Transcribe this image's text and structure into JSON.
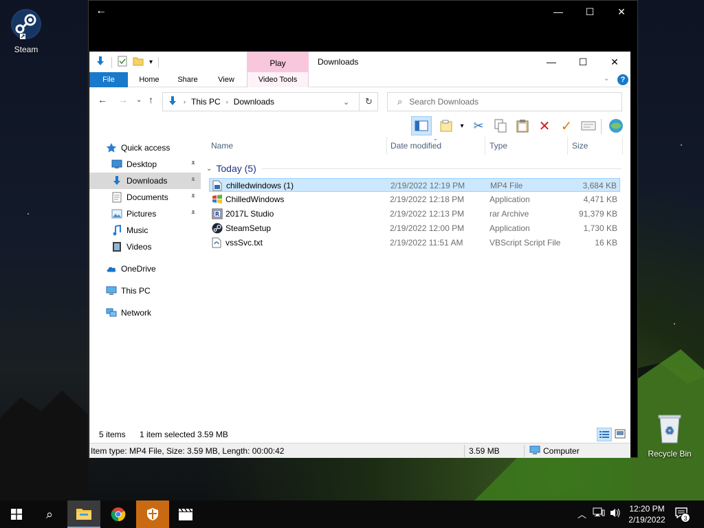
{
  "desktop": {
    "icons": [
      {
        "label": "Steam",
        "icon": "steam-icon"
      },
      {
        "label": "Recycle Bin",
        "icon": "recycle-bin-icon"
      }
    ]
  },
  "outer_window": {
    "back_glyph": "←",
    "minimize_glyph": "—",
    "maximize_glyph": "☐",
    "close_glyph": "✕"
  },
  "explorer": {
    "title": "Downloads",
    "contextual_tab_group": "Play",
    "ribbon_tabs": [
      "File",
      "Home",
      "Share",
      "View",
      "Video Tools"
    ],
    "address": {
      "crumbs": [
        "This PC",
        "Downloads"
      ]
    },
    "search_placeholder": "Search Downloads",
    "nav": [
      {
        "label": "Quick access",
        "icon": "star-icon",
        "indent": false,
        "pinned": false
      },
      {
        "label": "Desktop",
        "icon": "desktop-folder-icon",
        "indent": true,
        "pinned": true
      },
      {
        "label": "Downloads",
        "icon": "downloads-folder-icon",
        "indent": true,
        "pinned": true,
        "selected": true
      },
      {
        "label": "Documents",
        "icon": "documents-folder-icon",
        "indent": true,
        "pinned": true
      },
      {
        "label": "Pictures",
        "icon": "pictures-folder-icon",
        "indent": true,
        "pinned": true
      },
      {
        "label": "Music",
        "icon": "music-folder-icon",
        "indent": true,
        "pinned": false
      },
      {
        "label": "Videos",
        "icon": "videos-folder-icon",
        "indent": true,
        "pinned": false
      },
      {
        "label": "OneDrive",
        "icon": "onedrive-icon",
        "indent": false,
        "pinned": false
      },
      {
        "label": "This PC",
        "icon": "this-pc-icon",
        "indent": false,
        "pinned": false
      },
      {
        "label": "Network",
        "icon": "network-icon",
        "indent": false,
        "pinned": false
      }
    ],
    "columns": [
      "Name",
      "Date modified",
      "Type",
      "Size"
    ],
    "group": "Today (5)",
    "files": [
      {
        "name": "chilledwindows (1)",
        "date": "2/19/2022 12:19 PM",
        "type": "MP4 File",
        "size": "3,684 KB",
        "icon": "video-file-icon",
        "selected": true
      },
      {
        "name": "ChilledWindows",
        "date": "2/19/2022 12:18 PM",
        "type": "Application",
        "size": "4,471 KB",
        "icon": "windows-app-icon"
      },
      {
        "name": "2017L Studio",
        "date": "2/19/2022 12:13 PM",
        "type": "rar Archive",
        "size": "91,379 KB",
        "icon": "archive-icon"
      },
      {
        "name": "SteamSetup",
        "date": "2/19/2022 12:00 PM",
        "type": "Application",
        "size": "1,730 KB",
        "icon": "steam-icon"
      },
      {
        "name": "vssSvc.txt",
        "date": "2/19/2022 11:51 AM",
        "type": "VBScript Script File",
        "size": "16 KB",
        "icon": "script-file-icon"
      }
    ],
    "status": {
      "items": "5 items",
      "selected": "1 item selected  3.59 MB",
      "details": "Item type: MP4 File, Size: 3.59 MB, Length: 00:00:42",
      "size": "3.59 MB",
      "location": "Computer"
    }
  },
  "taskbar": {
    "time": "12:20 PM",
    "date": "2/19/2022",
    "notifications": "3"
  }
}
